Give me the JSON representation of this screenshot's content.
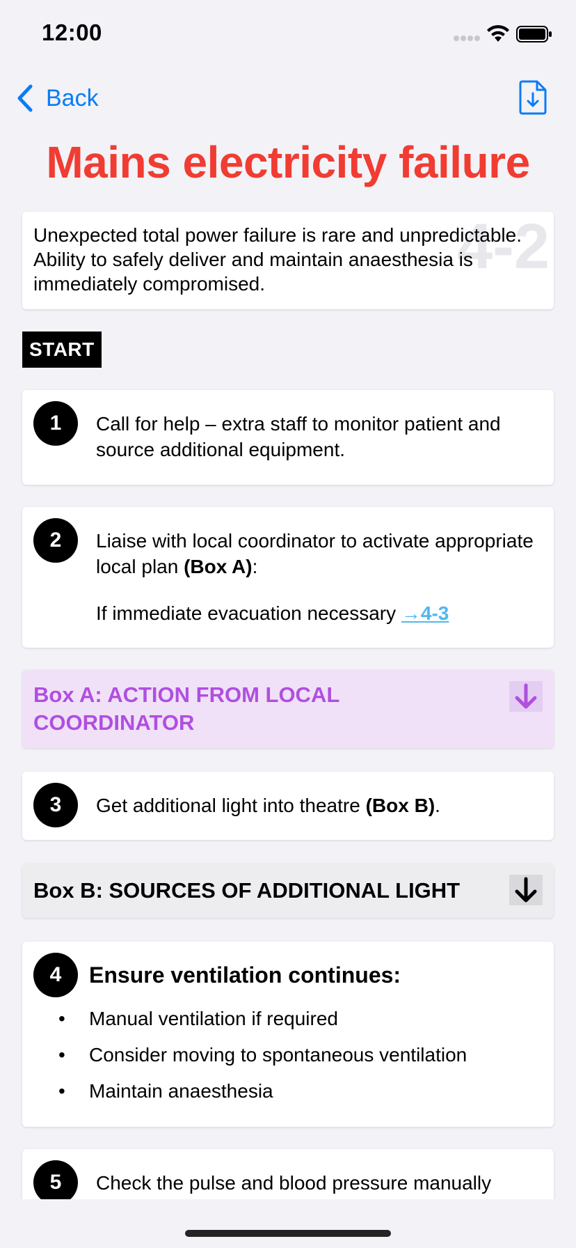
{
  "status_bar": {
    "time": "12:00"
  },
  "nav": {
    "back_label": "Back"
  },
  "title": "Mains electricity failure",
  "intro": {
    "watermark": "4-2",
    "text": "Unexpected total power failure is rare and unpredictable. Ability to safely deliver and maintain anaesthesia is immediately compromised."
  },
  "start_label": "START",
  "steps": [
    {
      "number": "1",
      "text": "Call for help – extra staff to monitor patient and source additional equipment."
    },
    {
      "number": "2",
      "text_pre": "Liaise with local coordinator to activate appropriate local plan ",
      "text_bold": "(Box A)",
      "text_post": ":",
      "sub_text": "If immediate evacuation necessary ",
      "link_label": "→4-3"
    },
    {
      "number": "3",
      "text_pre": "Get additional light into theatre ",
      "text_bold": "(Box B)",
      "text_post": "."
    },
    {
      "number": "4",
      "heading": "Ensure ventilation continues:",
      "bullets": [
        "Manual ventilation if required",
        "Consider moving to spontaneous ventilation",
        "Maintain anaesthesia"
      ]
    },
    {
      "number": "5",
      "text": "Check the pulse and blood pressure manually"
    }
  ],
  "box_a": {
    "title": "Box A: ACTION FROM LOCAL COORDINATOR"
  },
  "box_b": {
    "title": "Box B: SOURCES OF ADDITIONAL LIGHT"
  },
  "colors": {
    "title_red": "#f03c32",
    "link_blue": "#0a7cf5",
    "box_a_bg": "#f1e1f8",
    "box_a_text": "#b04fe0",
    "box_b_bg": "#ededef",
    "cross_ref_link": "#4fb8f0"
  },
  "icons": {
    "back": "chevron-left-icon",
    "download": "document-download-icon",
    "box_a_toggle": "arrow-down-icon",
    "box_b_toggle": "arrow-down-icon"
  }
}
